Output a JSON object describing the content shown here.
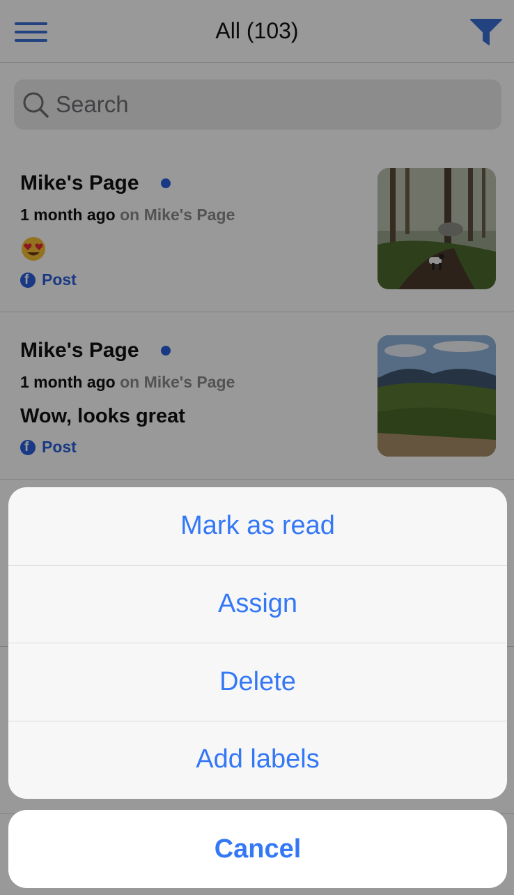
{
  "header": {
    "title": "All (103)",
    "accent_color": "#3b6fd6"
  },
  "search": {
    "placeholder": "Search",
    "value": ""
  },
  "feed": {
    "items": [
      {
        "author": "Mike's Page",
        "unread": true,
        "time": "1 month ago",
        "source": "on Mike's Page",
        "body": "😍",
        "type": "Post",
        "type_icon": "facebook-icon",
        "thumbnail": "forest-trail-with-dog-photo"
      },
      {
        "author": "Mike's Page",
        "unread": true,
        "time": "1 month ago",
        "source": "on Mike's Page",
        "body": "Wow, looks great",
        "type": "Post",
        "type_icon": "facebook-icon",
        "thumbnail": "mountain-valley-photo"
      }
    ]
  },
  "action_sheet": {
    "actions": [
      {
        "label": "Mark as read"
      },
      {
        "label": "Assign"
      },
      {
        "label": "Delete"
      },
      {
        "label": "Add labels"
      }
    ],
    "cancel_label": "Cancel",
    "action_color": "#3478f6"
  }
}
